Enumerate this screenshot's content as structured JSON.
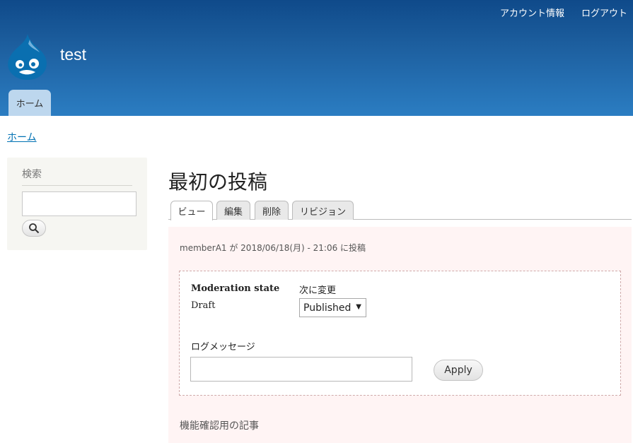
{
  "header": {
    "site_name": "test",
    "secondary_menu": [
      "アカウント情報",
      "ログアウト"
    ],
    "primary_tab": "ホーム",
    "colors": {
      "header_top": "#0f4a8a",
      "header_bottom": "#2b7dc2",
      "tab_bg": "#bdd7ee"
    }
  },
  "breadcrumb": {
    "home": "ホーム"
  },
  "sidebar": {
    "search_title": "検索",
    "search_placeholder": "",
    "search_button_icon": "search-icon"
  },
  "node": {
    "title": "最初の投稿",
    "tabs": [
      "ビュー",
      "編集",
      "削除",
      "リビジョン"
    ],
    "active_tab": "ビュー",
    "submitted": "memberA1 が 2018/06/18(月) - 21:06 に投稿",
    "moderation": {
      "state_label": "Moderation state",
      "state_value": "Draft",
      "change_label": "次に変更",
      "selected_option": "Published",
      "log_label": "ログメッセージ",
      "log_value": "",
      "apply_label": "Apply"
    },
    "body": "機能確認用の記事",
    "colors": {
      "content_bg": "#fff4f4",
      "link": "#0071b3"
    }
  }
}
